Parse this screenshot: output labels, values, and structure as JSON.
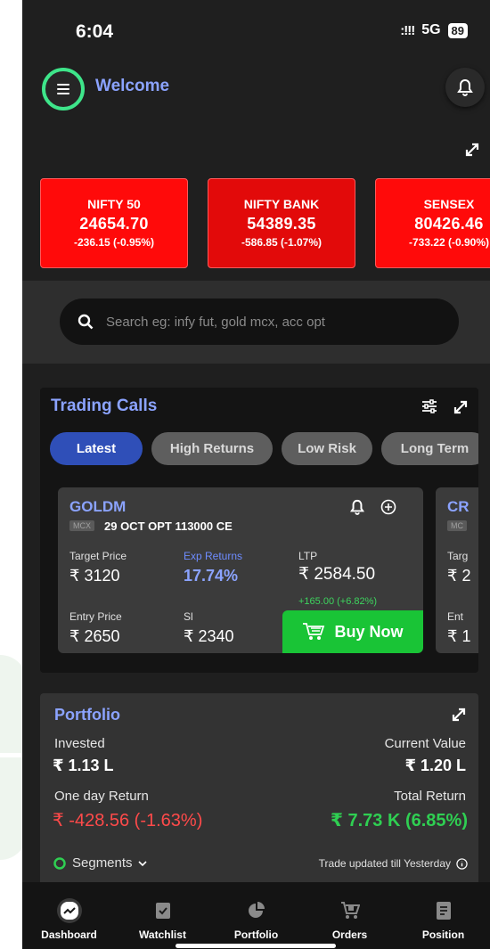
{
  "status_bar": {
    "time": "6:04",
    "signal": ":!!!",
    "network": "5G",
    "battery": "89"
  },
  "header": {
    "title": "Welcome"
  },
  "indices": [
    {
      "name": "NIFTY 50",
      "value": "24654.70",
      "change": "-236.15 (-0.95%)"
    },
    {
      "name": "NIFTY BANK",
      "value": "54389.35",
      "change": "-586.85 (-1.07%)"
    },
    {
      "name": "SENSEX",
      "value": "80426.46",
      "change": "-733.22 (-0.90%)"
    }
  ],
  "search": {
    "placeholder": "Search eg: infy fut, gold mcx, acc opt"
  },
  "trading_calls": {
    "title": "Trading Calls",
    "tabs": [
      "Latest",
      "High Returns",
      "Low Risk",
      "Long Term"
    ],
    "active_tab": "Latest",
    "card": {
      "symbol": "GOLDM",
      "exchange": "MCX",
      "contract": "29 OCT OPT 113000 CE",
      "target_label": "Target Price",
      "target_value": "₹ 3120",
      "exp_label": "Exp Returns",
      "exp_value": "17.74%",
      "ltp_label": "LTP",
      "ltp_value": "₹ 2584.50",
      "ltp_change": "+165.00 (+6.82%)",
      "entry_label": "Entry Price",
      "entry_value": "₹ 2650",
      "sl_label": "Sl",
      "sl_value": "₹ 2340",
      "buy_label": "Buy Now"
    },
    "card2": {
      "symbol": "CR",
      "exchange": "MC",
      "target_label": "Targ",
      "target_value": "₹ 2",
      "entry_label": "Ent",
      "entry_value": "₹ 1"
    }
  },
  "portfolio": {
    "title": "Portfolio",
    "invested_label": "Invested",
    "invested_value": "₹ 1.13 L",
    "current_label": "Current Value",
    "current_value": "₹ 1.20 L",
    "day_return_label": "One day Return",
    "day_return_value": "₹ -428.56 (-1.63%)",
    "total_return_label": "Total Return",
    "total_return_value": "₹ 7.73 K (6.85%)",
    "segments_label": "Segments",
    "updated_text": "Trade updated till Yesterday"
  },
  "bottom_nav": [
    {
      "label": "Dashboard",
      "icon": "chart-icon"
    },
    {
      "label": "Watchlist",
      "icon": "bookmark-icon"
    },
    {
      "label": "Portfolio",
      "icon": "pie-icon"
    },
    {
      "label": "Orders",
      "icon": "cart-icon"
    },
    {
      "label": "Position",
      "icon": "document-icon"
    }
  ],
  "colors": {
    "accent": "#8ba3ff",
    "loss": "#ff0a0a",
    "gain": "#19c436",
    "highlight_ring": "#3ee58a"
  }
}
